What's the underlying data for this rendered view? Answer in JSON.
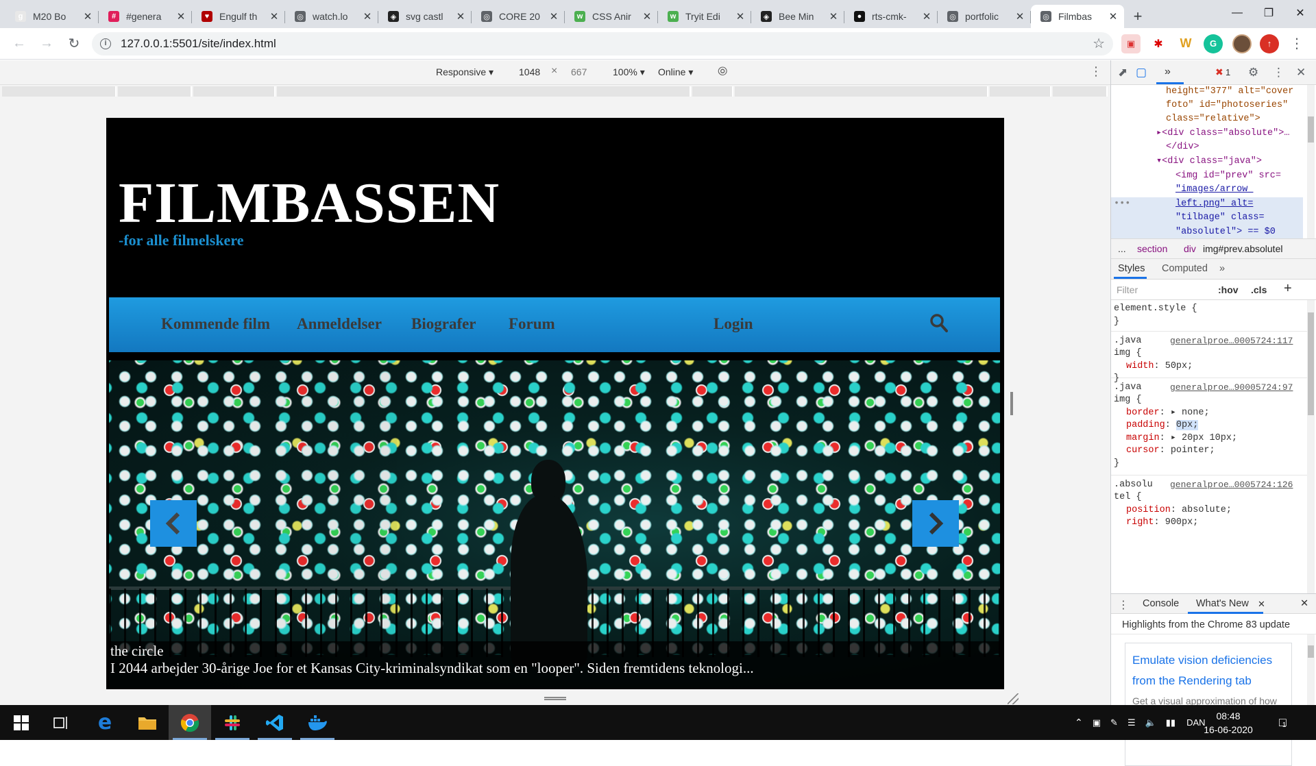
{
  "browser": {
    "tabs": [
      {
        "label": "M20 Bo",
        "favicon": "g-favicon",
        "color": "#e8e8e8",
        "glyph": "g"
      },
      {
        "label": "#genera",
        "favicon": "slack-favicon",
        "color": "#e01e5a",
        "glyph": "#"
      },
      {
        "label": "Engulf th",
        "favicon": "heart-favicon",
        "color": "#b00000",
        "glyph": "♥"
      },
      {
        "label": "watch.lo",
        "favicon": "globe-favicon",
        "color": "#5f6368",
        "glyph": "◎"
      },
      {
        "label": "svg castl",
        "favicon": "codepen-favicon",
        "color": "#222222",
        "glyph": "◈"
      },
      {
        "label": "CORE 20",
        "favicon": "globe-favicon",
        "color": "#5f6368",
        "glyph": "◎"
      },
      {
        "label": "CSS Anir",
        "favicon": "w3-favicon",
        "color": "#4caf50",
        "glyph": "w"
      },
      {
        "label": "Tryit Edi",
        "favicon": "w3-favicon",
        "color": "#4caf50",
        "glyph": "w"
      },
      {
        "label": "Bee Min",
        "favicon": "codepen-favicon",
        "color": "#222222",
        "glyph": "◈"
      },
      {
        "label": "rts-cmk-",
        "favicon": "github-favicon",
        "color": "#111111",
        "glyph": "●"
      },
      {
        "label": "portfolic",
        "favicon": "globe-favicon",
        "color": "#5f6368",
        "glyph": "◎"
      },
      {
        "label": "Filmbas",
        "favicon": "globe-favicon",
        "color": "#5f6368",
        "glyph": "◎",
        "active": true
      }
    ],
    "url": "127.0.0.1:5501/site/index.html"
  },
  "device_toolbar": {
    "mode": "Responsive ▾",
    "width": "1048",
    "times": "×",
    "height": "667",
    "zoom": "100% ▾",
    "network": "Online ▾"
  },
  "site": {
    "brand": "FILMBASSEN",
    "tagline": "-for alle filmelskere",
    "nav": [
      "Kommende film",
      "Anmeldelser",
      "Biografer",
      "Forum"
    ],
    "login": "Login",
    "hero": {
      "title": "the circle",
      "description": "I 2044 arbejder 30-årige Joe for et Kansas City-kriminalsyndikat som en \"looper\". Siden fremtidens teknologi..."
    }
  },
  "devtools": {
    "error_count": "1",
    "elements": [
      "height=\"377\" alt=\"cover",
      "foto\" id=\"photoseries\"",
      "class=\"relative\">",
      "▸<div class=\"absolute\">…",
      "</div>",
      "▾<div class=\"java\">",
      "<img id=\"prev\" src=",
      "\"images/arrow_",
      "left.png\" alt=",
      "\"tilbage\" class=",
      "\"absolutel\"> == $0"
    ],
    "breadcrumbs": [
      "...",
      "section",
      "div",
      "img#prev.absolutel"
    ],
    "subtabs": [
      "Styles",
      "Computed",
      "»"
    ],
    "filter_placeholder": "Filter",
    "hov": ":hov",
    "cls": ".cls",
    "rules": [
      {
        "selector": "element.style {",
        "source": "",
        "props": [],
        "close": "}"
      },
      {
        "selector": ".java",
        "selector2": "img {",
        "source": "generalproe…0005724:117",
        "props": [
          [
            "width",
            "50px;"
          ]
        ],
        "close": "}"
      },
      {
        "selector": ".java",
        "selector2": "img {",
        "source": "generalproe…90005724:97",
        "props": [
          [
            "border",
            "▸ none;"
          ],
          [
            "padding",
            "0px;"
          ],
          [
            "margin",
            "▸ 20px 10px;"
          ],
          [
            "cursor",
            "pointer;"
          ]
        ],
        "close": "}"
      },
      {
        "selector": ".absolu",
        "selector2": "tel {",
        "source": "generalproe…0005724:126",
        "props": [
          [
            "position",
            "absolute;"
          ],
          [
            "right",
            "900px;"
          ]
        ],
        "close": ""
      }
    ],
    "drawer_tabs": [
      "Console",
      "What's New"
    ],
    "whats_new_title": "Highlights from the Chrome 83 update",
    "card_title": "Emulate vision deficiencies from the Rendering tab",
    "card_desc": "Get a visual approximation of how people with vision deficiencies might experience your site."
  },
  "taskbar": {
    "lang": "DAN",
    "time": "08:48",
    "date": "16-06-2020",
    "notifications": "1"
  }
}
